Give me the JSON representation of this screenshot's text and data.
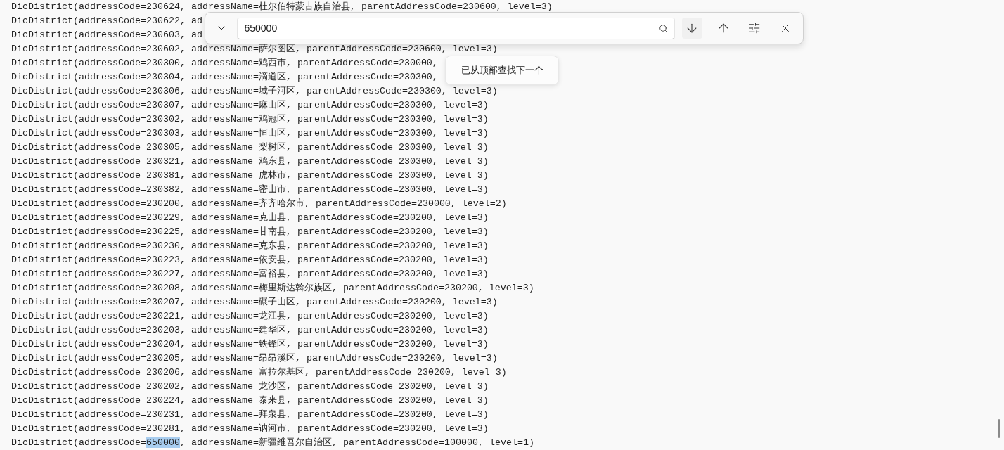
{
  "find_bar": {
    "query": "650000",
    "tooltip": "已从顶部查找下一个"
  },
  "lines": [
    {
      "text": "DicDistrict(addressCode=230624, addressName=杜尔伯特蒙古族自治县, parentAddressCode=230600, level=3)"
    },
    {
      "text": "DicDistrict(addressCode=230622, ad"
    },
    {
      "text": "DicDistrict(addressCode=230603, ad"
    },
    {
      "text": "DicDistrict(addressCode=230602, addressName=萨尔图区, parentAddressCode=230600, level=3)"
    },
    {
      "text": "DicDistrict(addressCode=230300, addressName=鸡西市, parentAddressCode=230000,"
    },
    {
      "text": "DicDistrict(addressCode=230304, addressName=滴道区, parentAddressCode=230300,"
    },
    {
      "text": "DicDistrict(addressCode=230306, addressName=城子河区, parentAddressCode=230300, level=3)"
    },
    {
      "text": "DicDistrict(addressCode=230307, addressName=麻山区, parentAddressCode=230300, level=3)"
    },
    {
      "text": "DicDistrict(addressCode=230302, addressName=鸡冠区, parentAddressCode=230300, level=3)"
    },
    {
      "text": "DicDistrict(addressCode=230303, addressName=恒山区, parentAddressCode=230300, level=3)"
    },
    {
      "text": "DicDistrict(addressCode=230305, addressName=梨树区, parentAddressCode=230300, level=3)"
    },
    {
      "text": "DicDistrict(addressCode=230321, addressName=鸡东县, parentAddressCode=230300, level=3)"
    },
    {
      "text": "DicDistrict(addressCode=230381, addressName=虎林市, parentAddressCode=230300, level=3)"
    },
    {
      "text": "DicDistrict(addressCode=230382, addressName=密山市, parentAddressCode=230300, level=3)"
    },
    {
      "text": "DicDistrict(addressCode=230200, addressName=齐齐哈尔市, parentAddressCode=230000, level=2)"
    },
    {
      "text": "DicDistrict(addressCode=230229, addressName=克山县, parentAddressCode=230200, level=3)"
    },
    {
      "text": "DicDistrict(addressCode=230225, addressName=甘南县, parentAddressCode=230200, level=3)"
    },
    {
      "text": "DicDistrict(addressCode=230230, addressName=克东县, parentAddressCode=230200, level=3)"
    },
    {
      "text": "DicDistrict(addressCode=230223, addressName=依安县, parentAddressCode=230200, level=3)"
    },
    {
      "text": "DicDistrict(addressCode=230227, addressName=富裕县, parentAddressCode=230200, level=3)"
    },
    {
      "text": "DicDistrict(addressCode=230208, addressName=梅里斯达斡尔族区, parentAddressCode=230200, level=3)"
    },
    {
      "text": "DicDistrict(addressCode=230207, addressName=碾子山区, parentAddressCode=230200, level=3)"
    },
    {
      "text": "DicDistrict(addressCode=230221, addressName=龙江县, parentAddressCode=230200, level=3)"
    },
    {
      "text": "DicDistrict(addressCode=230203, addressName=建华区, parentAddressCode=230200, level=3)"
    },
    {
      "text": "DicDistrict(addressCode=230204, addressName=铁锋区, parentAddressCode=230200, level=3)"
    },
    {
      "text": "DicDistrict(addressCode=230205, addressName=昂昂溪区, parentAddressCode=230200, level=3)"
    },
    {
      "text": "DicDistrict(addressCode=230206, addressName=富拉尔基区, parentAddressCode=230200, level=3)"
    },
    {
      "text": "DicDistrict(addressCode=230202, addressName=龙沙区, parentAddressCode=230200, level=3)"
    },
    {
      "text": "DicDistrict(addressCode=230224, addressName=泰来县, parentAddressCode=230200, level=3)"
    },
    {
      "text": "DicDistrict(addressCode=230231, addressName=拜泉县, parentAddressCode=230200, level=3)"
    },
    {
      "text": "DicDistrict(addressCode=230281, addressName=讷河市, parentAddressCode=230200, level=3)"
    },
    {
      "before": "DicDistrict(addressCode=",
      "match": "650000",
      "after": ", addressName=新疆维吾尔自治区, parentAddressCode=100000, level=1)"
    }
  ]
}
